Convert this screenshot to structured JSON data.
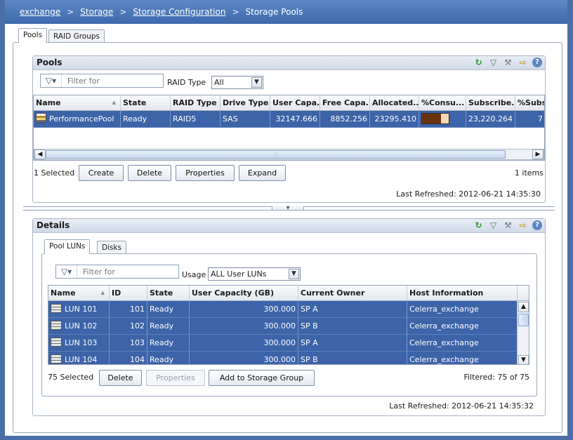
{
  "breadcrumb": {
    "items": [
      "exchange",
      "Storage",
      "Storage Configuration"
    ],
    "separator": ">",
    "current": "Storage Pools"
  },
  "tabs": {
    "pools": "Pools",
    "raid_groups": "RAID Groups"
  },
  "pools_section": {
    "title": "Pools",
    "filter_placeholder": "Filter for",
    "raid_type_label": "RAID Type",
    "raid_type_value": "All",
    "columns": [
      "Name",
      "State",
      "RAID Type",
      "Drive Type",
      "User Capa...",
      "Free Capa...",
      "Allocated...",
      "%Consu...",
      "Subscribe...",
      "%Subs"
    ],
    "rows": [
      {
        "name": "PerformancePool",
        "state": "Ready",
        "raid_type": "RAID5",
        "drive_type": "SAS",
        "user_capacity": "32147.666",
        "free_capacity": "8852.256",
        "allocated": "23295.410",
        "percent_consumed": 72,
        "subscribed": "23,220.264",
        "percent_subscribed": "7"
      }
    ],
    "selected_text": "1 Selected",
    "buttons": {
      "create": "Create",
      "delete": "Delete",
      "properties": "Properties",
      "expand": "Expand"
    },
    "items_count": "1 items",
    "last_refreshed": "Last Refreshed: 2012-06-21 14:35:30"
  },
  "details_section": {
    "title": "Details",
    "tabs": {
      "pool_luns": "Pool LUNs",
      "disks": "Disks"
    },
    "filter_placeholder": "Filter for",
    "usage_label": "Usage",
    "usage_value": "ALL User LUNs",
    "columns": [
      "Name",
      "ID",
      "State",
      "User Capacity (GB)",
      "Current Owner",
      "Host Information"
    ],
    "rows": [
      {
        "name": "LUN 101",
        "id": "101",
        "state": "Ready",
        "capacity": "300.000",
        "owner": "SP A",
        "host": "Celerra_exchange"
      },
      {
        "name": "LUN 102",
        "id": "102",
        "state": "Ready",
        "capacity": "300.000",
        "owner": "SP B",
        "host": "Celerra_exchange"
      },
      {
        "name": "LUN 103",
        "id": "103",
        "state": "Ready",
        "capacity": "300.000",
        "owner": "SP A",
        "host": "Celerra_exchange"
      },
      {
        "name": "LUN 104",
        "id": "104",
        "state": "Ready",
        "capacity": "300.000",
        "owner": "SP B",
        "host": "Celerra_exchange"
      }
    ],
    "selected_text": "75 Selected",
    "buttons": {
      "delete": "Delete",
      "properties": "Properties",
      "add_to_group": "Add to Storage Group"
    },
    "filtered_text": "Filtered: 75 of 75",
    "last_refreshed": "Last Refreshed: 2012-06-21 14:35:32"
  },
  "toolbar_icons": [
    "refresh-icon",
    "filter-icon",
    "wrench-icon",
    "export-icon",
    "help-icon"
  ],
  "colors": {
    "selection": "#3d63a8",
    "header_bar": "#4a6fa8",
    "consumed_fill": "#6b3210"
  }
}
